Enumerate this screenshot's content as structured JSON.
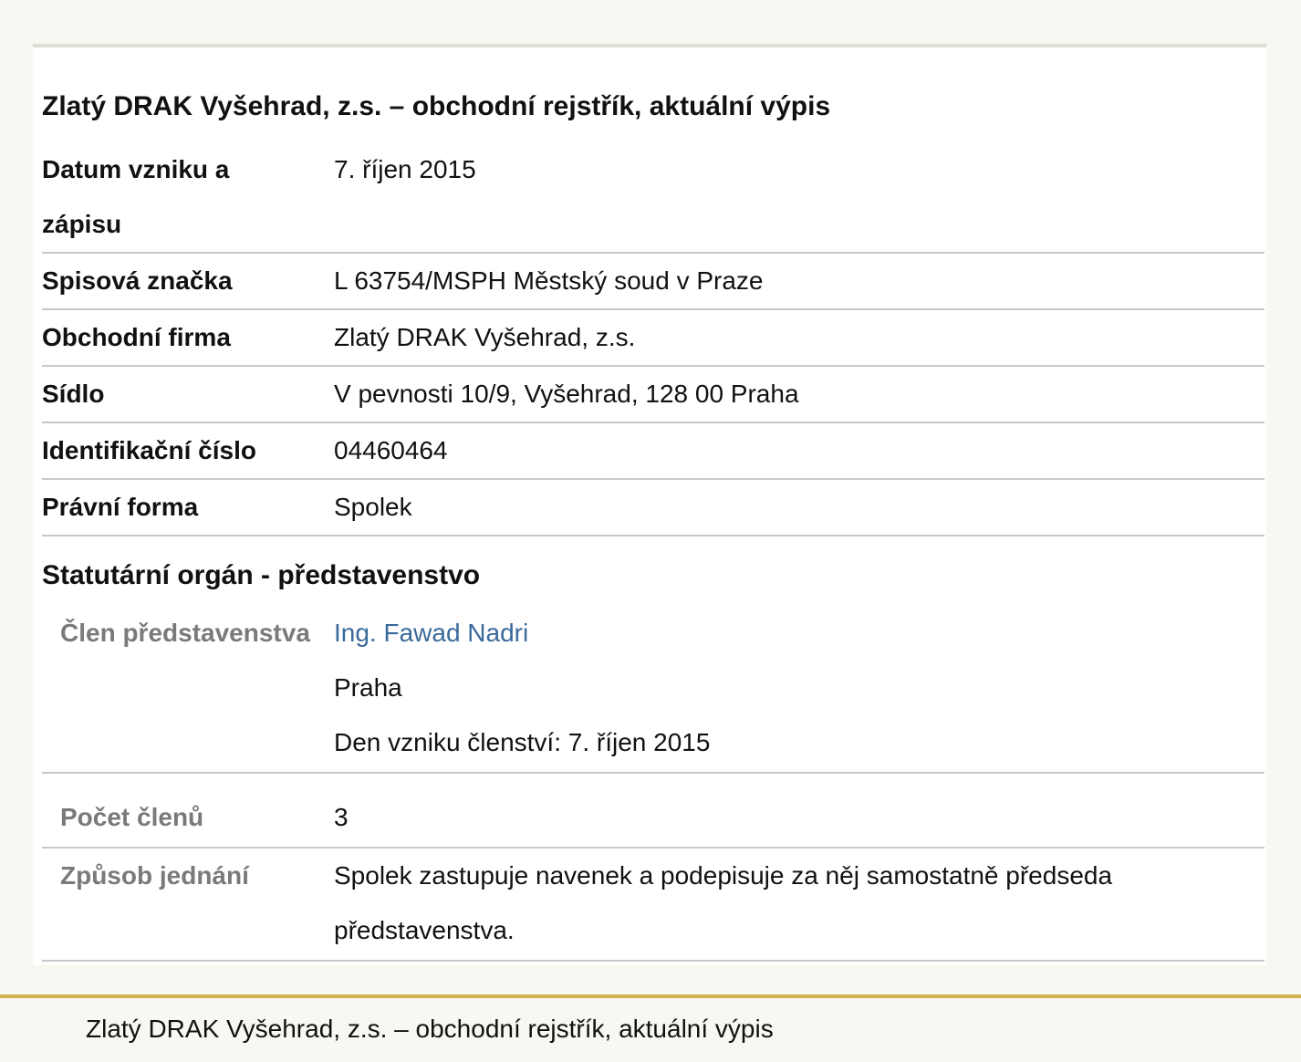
{
  "header": {
    "title": "Zlatý DRAK Vyšehrad, z.s. – obchodní rejstřík, aktuální výpis"
  },
  "rows": [
    {
      "label_line1": "Datum vzniku a",
      "label_line2": "zápisu",
      "value": "7. říjen 2015"
    },
    {
      "label": "Spisová značka",
      "value": "L 63754/MSPH Městský soud v Praze"
    },
    {
      "label": "Obchodní firma",
      "value": "Zlatý DRAK Vyšehrad, z.s."
    },
    {
      "label": "Sídlo",
      "value": "V pevnosti 10/9, Vyšehrad, 128 00 Praha"
    },
    {
      "label": "Identifikační číslo",
      "value": "04460464"
    },
    {
      "label": "Právní forma",
      "value": "Spolek"
    }
  ],
  "statutory": {
    "title": "Statutární orgán - představenstvo",
    "member": {
      "label": "Člen představenstva",
      "name": "Ing. Fawad Nadri",
      "city": "Praha",
      "since": "Den vzniku členství: 7. říjen 2015"
    },
    "count": {
      "label": "Počet členů",
      "value": "3"
    },
    "conduct": {
      "label": "Způsob jednání",
      "value_line1": "Spolek zastupuje navenek a podepisuje za něj samostatně předseda",
      "value_line2": "představenstva."
    }
  },
  "footer": {
    "text": "Zlatý DRAK Vyšehrad, z.s. – obchodní rejstřík, aktuální výpis"
  }
}
